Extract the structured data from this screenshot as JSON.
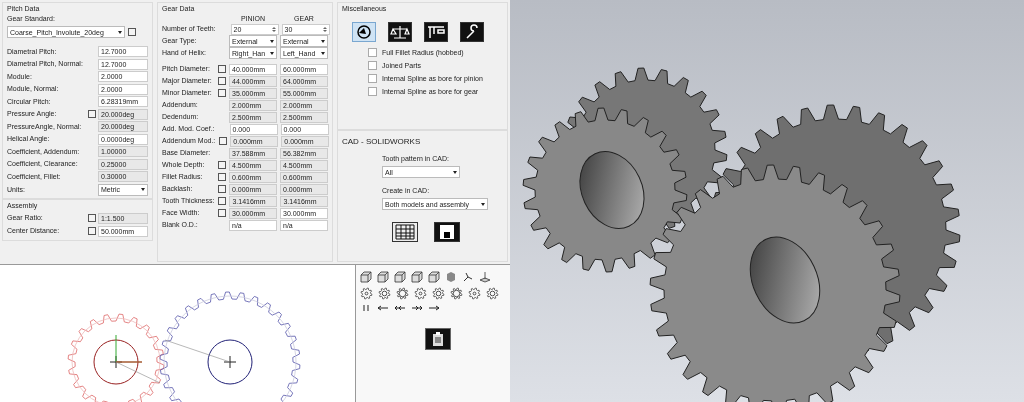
{
  "pitch_data": {
    "title": "Pitch Data",
    "gear_standard": {
      "label": "Gear Standard:",
      "value": "Coarse_Pitch_Involute_20deg",
      "checked": false
    },
    "rows": [
      {
        "kind": "text",
        "label": "Diametral Pitch:",
        "value": "12.7000",
        "readonly": false
      },
      {
        "kind": "text",
        "label": "Diametral Pitch, Normal:",
        "value": "12.7000",
        "readonly": false
      },
      {
        "kind": "text",
        "label": "Module:",
        "value": "2.0000",
        "readonly": false
      },
      {
        "kind": "text",
        "label": "Module, Normal:",
        "value": "2.0000",
        "readonly": false
      },
      {
        "kind": "text",
        "label": "Circular Pitch:",
        "value": "6.28319mm",
        "readonly": false
      },
      {
        "kind": "check",
        "label": "Pressure Angle:",
        "value": "20.000deg",
        "readonly": true,
        "checked": false
      },
      {
        "kind": "text",
        "label": "PressureAngle, Normal:",
        "value": "20.000deg",
        "readonly": true
      },
      {
        "kind": "text",
        "label": "Helical Angle:",
        "value": "0.0000deg",
        "readonly": false
      },
      {
        "kind": "text",
        "label": "Coefficient, Addendum:",
        "value": "1.00000",
        "readonly": true
      },
      {
        "kind": "text",
        "label": "Coefficient, Clearance:",
        "value": "0.25000",
        "readonly": true
      },
      {
        "kind": "text",
        "label": "Coefficient, Fillet:",
        "value": "0.30000",
        "readonly": true
      },
      {
        "kind": "dropdown",
        "label": "Units:",
        "value": "Metric",
        "readonly": false
      }
    ]
  },
  "assembly": {
    "title": "Assembly",
    "rows": [
      {
        "kind": "check",
        "label": "Gear Ratio:",
        "value": "1:1.500",
        "readonly": true,
        "checked": false
      },
      {
        "kind": "check",
        "label": "Center Distance:",
        "value": "50.000mm",
        "readonly": false,
        "checked": false
      }
    ]
  },
  "gear_data": {
    "title": "Gear Data",
    "columns": [
      "PINION",
      "GEAR"
    ],
    "rows": [
      {
        "kind": "spin",
        "label": "Number of Teeth:",
        "pinion": {
          "value": "20",
          "readonly": false
        },
        "gear": {
          "value": "30",
          "readonly": false
        }
      },
      {
        "kind": "dropdown",
        "label": "Gear Type:",
        "pinion": {
          "value": "External",
          "readonly": false
        },
        "gear": {
          "value": "External",
          "readonly": false
        }
      },
      {
        "kind": "dropdown",
        "label": "Hand of Helix:",
        "pinion": {
          "value": "Right_Han",
          "readonly": false
        },
        "gear": {
          "value": "Left_Hand",
          "readonly": false
        }
      },
      {
        "kind": "check",
        "label": "Pitch Diameter:",
        "checked": false,
        "pinion": {
          "value": "40.000mm",
          "readonly": false
        },
        "gear": {
          "value": "60.000mm",
          "readonly": false
        }
      },
      {
        "kind": "check",
        "label": "Major Diameter:",
        "checked": false,
        "pinion": {
          "value": "44.000mm",
          "readonly": true
        },
        "gear": {
          "value": "64.000mm",
          "readonly": true
        }
      },
      {
        "kind": "check",
        "label": "Minor Diameter:",
        "checked": false,
        "pinion": {
          "value": "35.000mm",
          "readonly": true
        },
        "gear": {
          "value": "55.000mm",
          "readonly": true
        }
      },
      {
        "kind": "text",
        "label": "Addendum:",
        "pinion": {
          "value": "2.000mm",
          "readonly": true
        },
        "gear": {
          "value": "2.000mm",
          "readonly": true
        }
      },
      {
        "kind": "text",
        "label": "Dedendum:",
        "pinion": {
          "value": "2.500mm",
          "readonly": true
        },
        "gear": {
          "value": "2.500mm",
          "readonly": true
        }
      },
      {
        "kind": "text",
        "label": "Add. Mod. Coef.:",
        "pinion": {
          "value": "0.000",
          "readonly": false
        },
        "gear": {
          "value": "0.000",
          "readonly": false
        }
      },
      {
        "kind": "check",
        "label": "Addendum Mod.:",
        "checked": false,
        "pinion": {
          "value": "0.000mm",
          "readonly": true
        },
        "gear": {
          "value": "0.000mm",
          "readonly": true
        }
      },
      {
        "kind": "text",
        "label": "Base Diameter:",
        "pinion": {
          "value": "37.588mm",
          "readonly": true
        },
        "gear": {
          "value": "56.382mm",
          "readonly": true
        }
      },
      {
        "kind": "check",
        "label": "Whole Depth:",
        "checked": false,
        "pinion": {
          "value": "4.500mm",
          "readonly": true
        },
        "gear": {
          "value": "4.500mm",
          "readonly": true
        }
      },
      {
        "kind": "check",
        "label": "Fillet Radius:",
        "checked": false,
        "pinion": {
          "value": "0.600mm",
          "readonly": true
        },
        "gear": {
          "value": "0.600mm",
          "readonly": true
        }
      },
      {
        "kind": "check",
        "label": "Backlash:",
        "checked": false,
        "pinion": {
          "value": "0.000mm",
          "readonly": true
        },
        "gear": {
          "value": "0.000mm",
          "readonly": true
        }
      },
      {
        "kind": "check",
        "label": "Tooth Thickness:",
        "checked": false,
        "pinion": {
          "value": "3.1416mm",
          "readonly": true
        },
        "gear": {
          "value": "3.1416mm",
          "readonly": true
        }
      },
      {
        "kind": "check",
        "label": "Face Width:",
        "checked": false,
        "pinion": {
          "value": "30.000mm",
          "readonly": true
        },
        "gear": {
          "value": "30.000mm",
          "readonly": false
        }
      },
      {
        "kind": "text",
        "label": "Blank O.D.:",
        "pinion": {
          "value": "n/a",
          "readonly": false
        },
        "gear": {
          "value": "n/a",
          "readonly": false
        }
      }
    ]
  },
  "miscellaneous": {
    "title": "Miscellaneous",
    "tools": [
      {
        "kind": "gauge",
        "selected": true
      },
      {
        "kind": "balance",
        "selected": false
      },
      {
        "kind": "caliper",
        "selected": false
      },
      {
        "kind": "wrench",
        "selected": false
      }
    ],
    "options": [
      {
        "label": "Full Fillet Radius (hobbed)",
        "checked": false
      },
      {
        "label": "Joined Parts",
        "checked": false
      },
      {
        "label": "Internal Spline as bore for pinion",
        "checked": false
      },
      {
        "label": "Internal Spline as bore for gear",
        "checked": false
      }
    ]
  },
  "cad": {
    "title": "CAD - SOLIDWORKS",
    "tooth_pattern": {
      "label": "Tooth pattern in CAD:",
      "value": "All"
    },
    "create": {
      "label": "Create in CAD:",
      "value": "Both models and assembly"
    },
    "buttons": [
      {
        "kind": "table"
      },
      {
        "kind": "save"
      }
    ]
  }
}
